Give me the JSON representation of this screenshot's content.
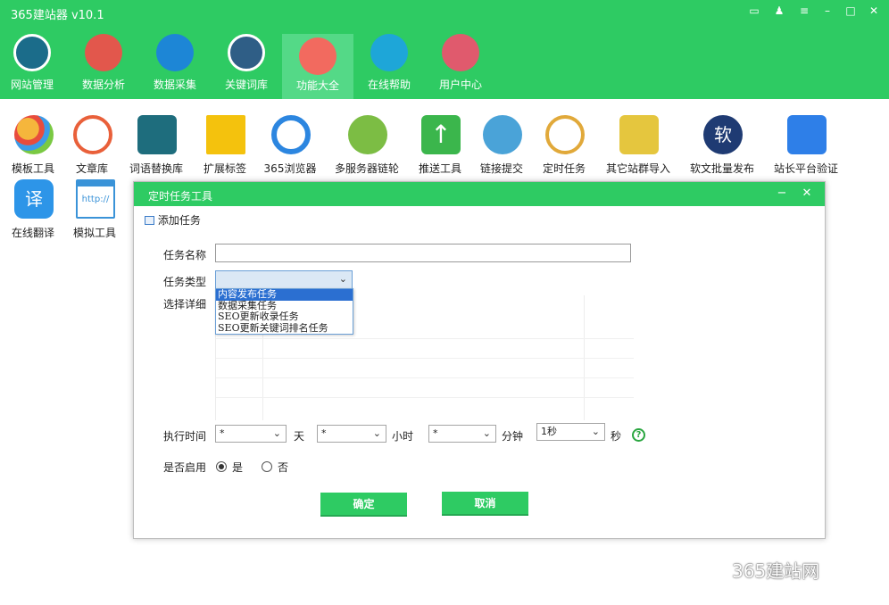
{
  "app": {
    "title": "365建站器 v10.1"
  },
  "nav": [
    {
      "label": "网站管理",
      "color": "#1b6c8a"
    },
    {
      "label": "数据分析",
      "color": "#e2574c"
    },
    {
      "label": "数据采集",
      "color": "#1d86d6"
    },
    {
      "label": "关键词库",
      "color": "#2f5e86"
    },
    {
      "label": "功能大全",
      "color": "#f26a5f",
      "active": true
    },
    {
      "label": "在线帮助",
      "color": "#1ea6d8"
    },
    {
      "label": "用户中心",
      "color": "#e05a6d"
    }
  ],
  "tools": [
    {
      "label": "模板工具",
      "color": "#f5b63c"
    },
    {
      "label": "文章库",
      "color": "#e9603a"
    },
    {
      "label": "词语替换库",
      "color": "#1e6d7d"
    },
    {
      "label": "扩展标签",
      "color": "#f4c20d"
    },
    {
      "label": "365浏览器",
      "color": "#2c86e0"
    },
    {
      "label": "多服务器链轮",
      "color": "#7cbd44"
    },
    {
      "label": "推送工具",
      "color": "#3bb64c"
    },
    {
      "label": "链接提交",
      "color": "#4aa3d8"
    },
    {
      "label": "定时任务",
      "color": "#e1a93a"
    },
    {
      "label": "其它站群导入",
      "color": "#e5c63e"
    },
    {
      "label": "软文批量发布",
      "color": "#1f3b73"
    },
    {
      "label": "站长平台验证",
      "color": "#2e7fe8"
    },
    {
      "label": "在线翻译",
      "color": "#2d95e8"
    },
    {
      "label": "模拟工具",
      "color": "#3a93d8"
    }
  ],
  "dialog": {
    "title": "定时任务工具",
    "tab": "添加任务",
    "name_label": "任务名称",
    "type_label": "任务类型",
    "detail_label": "选择详细",
    "time_label": "执行时间",
    "enable_label": "是否启用",
    "type_options": [
      "内容发布任务",
      "数据采集任务",
      "SEO更新收录任务",
      "SEO更新关键词排名任务"
    ],
    "day_value": "*",
    "day_unit": "天",
    "hour_value": "*",
    "hour_unit": "小时",
    "minute_value": "*",
    "minute_unit": "分钟",
    "second_value": "1秒",
    "second_unit": "秒",
    "yes": "是",
    "no": "否",
    "ok": "确定",
    "cancel": "取消"
  },
  "watermark": "365建站网",
  "icons": {
    "help": "?",
    "minimize": "−",
    "close": "✕",
    "chevron": "⌵"
  }
}
